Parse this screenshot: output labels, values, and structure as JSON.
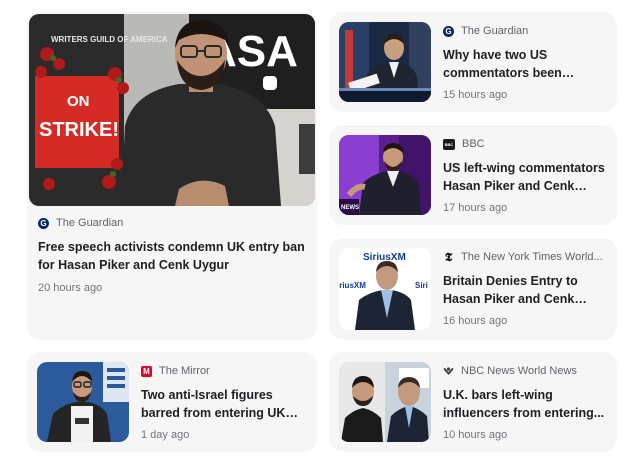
{
  "articles": [
    {
      "source": "The Guardian",
      "source_icon": "guardian-logo-icon",
      "title": "Free speech activists condemn UK entry ban for Hasan Piker and Cenk Uygur",
      "time": "20 hours ago",
      "image": "man-with-glasses-before-strike-sign-image",
      "image_text": {
        "sign_on": "ON",
        "sign_strike": "STRIKE!",
        "sign_top": "WRITERS GUILD OF AMERICA",
        "backdrop": "ASA"
      }
    },
    {
      "source": "The Guardian",
      "source_icon": "guardian-logo-icon",
      "title": "Why have two US commentators been banne...",
      "time": "15 hours ago",
      "image": "host-at-desk-image"
    },
    {
      "source": "BBC",
      "source_icon": "bbc-logo-icon",
      "title": "US left-wing commentators Hasan Piker and Cenk Uygu...",
      "time": "17 hours ago",
      "image": "man-on-stage-purple-image",
      "image_text": {
        "badge": "NEWS"
      }
    },
    {
      "source": "The New York Times World...",
      "source_icon": "nyt-logo-icon",
      "title": "Britain Denies Entry to Hasan Piker and Cenk Uygur",
      "time": "16 hours ago",
      "image": "man-before-siriusxm-backdrop-image",
      "image_text": {
        "brand": "SiriusXM",
        "brand_short": "iriusXM"
      }
    },
    {
      "source": "The Mirror",
      "source_icon": "mirror-logo-icon",
      "title": "Two anti-Israel figures barred from entering UK ahead of...",
      "time": "1 day ago",
      "image": "man-with-glasses-blue-backdrop-image"
    },
    {
      "source": "NBC News World News",
      "source_icon": "nbc-logo-icon",
      "title": "U.K. bars left-wing influencers from entering...",
      "time": "10 hours ago",
      "image": "two-men-split-image"
    }
  ],
  "colors": {
    "card_bg": "#f6f6f7",
    "guardian": "#052962",
    "bbc": "#1a1a1a",
    "mirror": "#e4002b",
    "nbc": "#444444"
  }
}
